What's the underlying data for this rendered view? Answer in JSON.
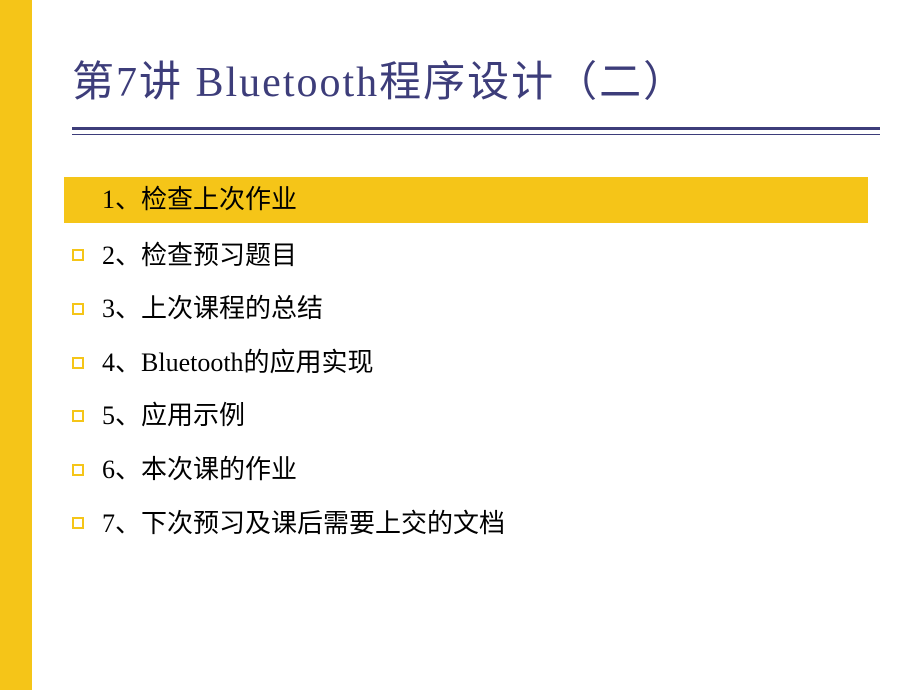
{
  "title": "第7讲 Bluetooth程序设计（二）",
  "items": [
    {
      "text": "1、检查上次作业",
      "highlighted": true
    },
    {
      "text": "2、检查预习题目",
      "highlighted": false
    },
    {
      "text": "3、上次课程的总结",
      "highlighted": false
    },
    {
      "text": "4、Bluetooth的应用实现",
      "highlighted": false
    },
    {
      "text": "5、应用示例",
      "highlighted": false
    },
    {
      "text": "6、本次课的作业",
      "highlighted": false
    },
    {
      "text": "7、下次预习及课后需要上交的文档",
      "highlighted": false
    }
  ]
}
